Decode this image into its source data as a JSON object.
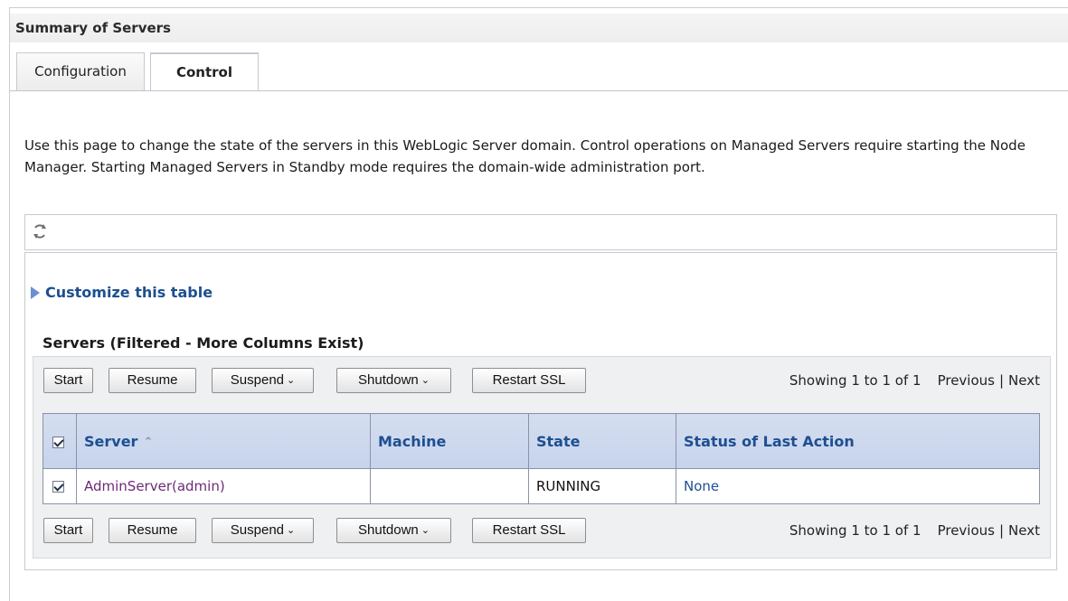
{
  "page": {
    "title": "Summary of Servers",
    "tabs": [
      {
        "label": "Configuration",
        "active": false
      },
      {
        "label": "Control",
        "active": true
      }
    ],
    "intro": "Use this page to change the state of the servers in this WebLogic Server domain. Control operations on Managed Servers require starting the Node Manager. Starting Managed Servers in Standby mode requires the domain-wide administration port."
  },
  "toolbar": {
    "refresh_icon": "refresh-icon"
  },
  "customize": {
    "label": "Customize this table",
    "icon": "expand-triangle-icon"
  },
  "table": {
    "title": "Servers (Filtered - More Columns Exist)",
    "buttons": {
      "start": "Start",
      "resume": "Resume",
      "suspend": "Suspend",
      "shutdown": "Shutdown",
      "restart_ssl": "Restart SSL"
    },
    "paging": {
      "showing": "Showing 1 to 1 of 1",
      "previous": "Previous",
      "separator": "|",
      "next": "Next"
    },
    "columns": [
      "Server",
      "Machine",
      "State",
      "Status of Last Action"
    ],
    "rows": [
      {
        "checked": true,
        "server": "AdminServer(admin)",
        "machine": "",
        "state": "RUNNING",
        "status": "None"
      }
    ]
  },
  "colors": {
    "link": "#1d4f91",
    "visited_link": "#6d2a78",
    "header_bg": "#c6d3ec"
  }
}
